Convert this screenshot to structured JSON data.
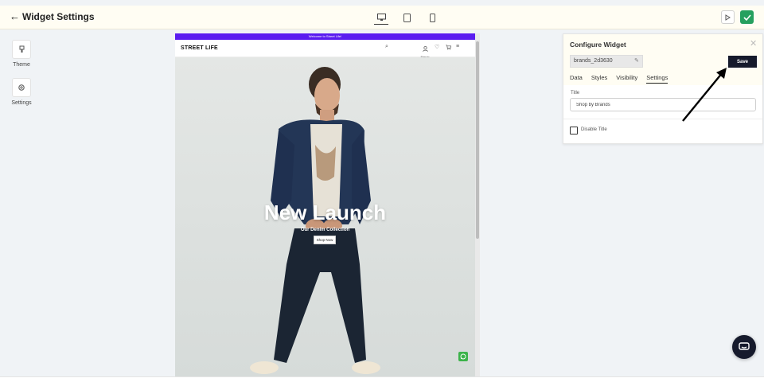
{
  "header": {
    "back_icon": "arrow-left-icon",
    "title": "Widget Settings",
    "devices": [
      {
        "icon": "desktop-icon",
        "active": true
      },
      {
        "icon": "tablet-icon",
        "active": false
      },
      {
        "icon": "mobile-icon",
        "active": false
      }
    ],
    "preview_icon": "play-icon",
    "publish_icon": "check-icon",
    "publish_color": "#25a05f"
  },
  "sidebar": {
    "items": [
      {
        "label": "Theme",
        "icon": "brush-icon"
      },
      {
        "label": "Settings",
        "icon": "gear-icon"
      }
    ]
  },
  "preview": {
    "announcement": "Welcome to Street Life!",
    "announcement_color": "#5a1cf0",
    "logo": "STREET LIFE",
    "account_label": "Sign In",
    "hero_title": "New Launch",
    "hero_subtitle": "Our Denim Collection",
    "hero_button": "Shop Now"
  },
  "config": {
    "title": "Configure Widget",
    "widget_id": "brands_2d3630",
    "save_label": "Save",
    "tabs": [
      "Data",
      "Styles",
      "Visibility",
      "Settings"
    ],
    "active_tab": "Settings",
    "title_label": "Title",
    "title_value": "Shop by Brands",
    "disable_title_label": "Disable Title",
    "disable_title_checked": false
  },
  "colors": {
    "save_button": "#161a2c",
    "chat_button": "#161a2c",
    "whatsapp": "#3cb34a"
  }
}
